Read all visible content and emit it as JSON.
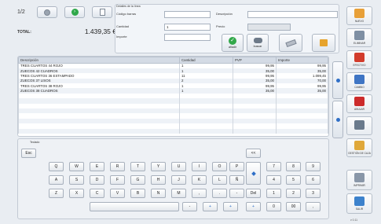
{
  "pager": {
    "current": "1/2"
  },
  "totals": {
    "label": "TOTAL:",
    "value": "1.439,35 €"
  },
  "detail": {
    "header": "Detalles de la línea",
    "labels": {
      "codigo": "Código barras",
      "cantidad": "Cantidad",
      "importe": "Importe",
      "descripcion": "Descripción",
      "precio": "Precio"
    },
    "values": {
      "codigo": "",
      "cantidad": "1",
      "importe": "",
      "descripcion": "",
      "precio": ""
    },
    "buttons": {
      "add": "añadir",
      "search": "buscar"
    }
  },
  "table": {
    "columns": [
      "Descripción",
      "Cantidad",
      "PVP",
      "Importe"
    ],
    "rows": [
      [
        "TRES CUARTOS 44 ROJO",
        "1",
        "99,95",
        "99,95"
      ],
      [
        "ZUECOS 42 CUADROS",
        "1",
        "35,00",
        "35,00"
      ],
      [
        "TRES CUARTOS 36 ESTAMPADO",
        "11",
        "99,95",
        "1.099,45"
      ],
      [
        "ZUECOS 37 LISOS",
        "2",
        "35,00",
        "70,00"
      ],
      [
        "TRES CUARTOS 38 ROJO",
        "1",
        "99,95",
        "99,95"
      ],
      [
        "ZUECOS 38 CUADROS",
        "1",
        "35,00",
        "35,00"
      ]
    ]
  },
  "keyboard": {
    "title": "Teclado",
    "esc": "Esc",
    "backspace": "<<",
    "row1": [
      "Q",
      "W",
      "E",
      "R",
      "T",
      "Y",
      "U",
      "I",
      "O",
      "P"
    ],
    "row2": [
      "A",
      "S",
      "D",
      "F",
      "G",
      "H",
      "J",
      "K",
      "L",
      "Ñ"
    ],
    "row3": [
      "Z",
      "X",
      "C",
      "V",
      "B",
      "N",
      "M",
      ",",
      ".",
      "-"
    ],
    "row4": [
      "-",
      "+",
      "+",
      "+"
    ],
    "del": "Del",
    "numpad": [
      "7",
      "8",
      "9",
      "4",
      "5",
      "6",
      "1",
      "2",
      "3",
      "0",
      "00",
      ","
    ]
  },
  "sidebar": [
    {
      "label": "nuevo",
      "icon": "new-ticket-icon",
      "color": "#e8a038"
    },
    {
      "label": "eliminar",
      "icon": "delete-ticket-icon",
      "color": "#7f8fa3"
    },
    {
      "label": "efectivo",
      "icon": "cash-icon",
      "color": "#d23c2c"
    },
    {
      "label": "cambio",
      "icon": "change-icon",
      "color": "#3f75c4"
    },
    {
      "label": "anular",
      "icon": "cancel-icon",
      "color": "#cc2b2b"
    },
    {
      "label": "",
      "icon": "user-icon",
      "color": "#6a7a8c"
    },
    {
      "label": "gestión de caja",
      "icon": "cash-drawer-icon",
      "color": "#e0a83a"
    },
    {
      "label": "imprimir",
      "icon": "printer-icon",
      "color": "#8a97a8"
    },
    {
      "label": "salir",
      "icon": "exit-icon",
      "color": "#3d82cc"
    }
  ],
  "footer": {
    "version": "v 0.11"
  }
}
